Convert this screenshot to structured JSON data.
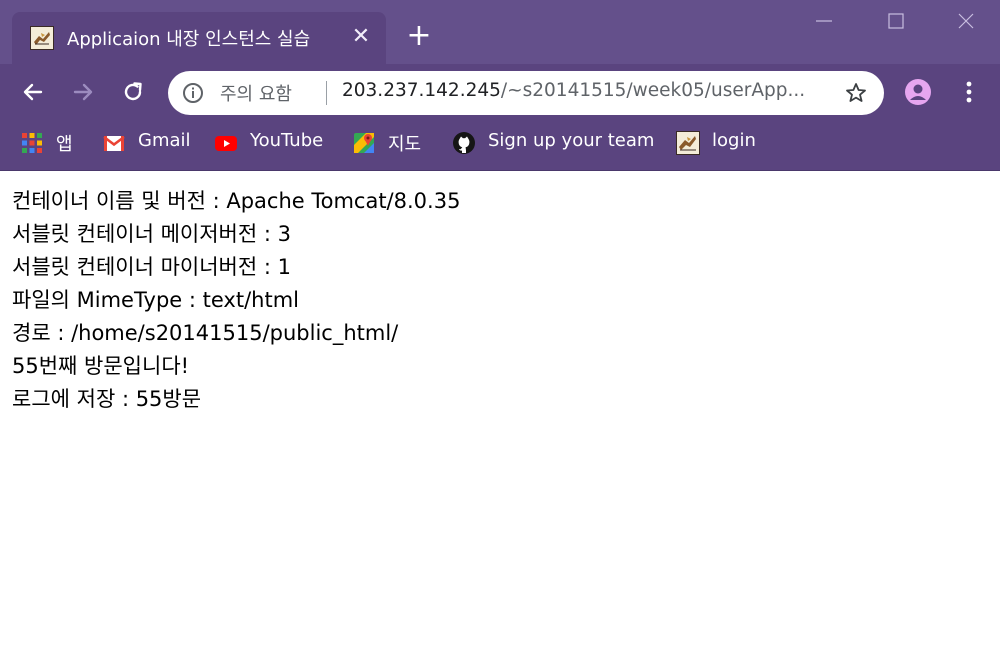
{
  "tab": {
    "title": "Applicaion 내장 인스턴스 실습",
    "close_glyph": "✕"
  },
  "new_tab_glyph": "+",
  "omnibox": {
    "security_label": "주의 요함",
    "url_host": "203.237.142.245",
    "url_path": "/~s20141515/week05/userApp..."
  },
  "bookmarks": [
    {
      "label": "앱",
      "icon": "apps-grid-icon"
    },
    {
      "label": "Gmail",
      "icon": "gmail-icon"
    },
    {
      "label": "YouTube",
      "icon": "youtube-icon"
    },
    {
      "label": "지도",
      "icon": "maps-icon"
    },
    {
      "label": "Sign up your team",
      "icon": "github-icon"
    },
    {
      "label": "login",
      "icon": "site-favicon-icon"
    }
  ],
  "page": {
    "lines": [
      "컨테이너 이름 및 버전 : Apache Tomcat/8.0.35",
      "서블릿 컨테이너 메이저버전 : 3",
      "서블릿 컨테이너 마이너버전 : 1",
      "파일의 MimeType : text/html",
      "경로 : /home/s20141515/public_html/",
      "55번째 방문입니다!",
      "로그에 저장 : 55방문"
    ]
  },
  "colors": {
    "frame": "#64508b",
    "toolbar": "#5a447f",
    "omnibox": "#ffffff",
    "page_background": "#ffffff",
    "page_text": "#000000"
  }
}
